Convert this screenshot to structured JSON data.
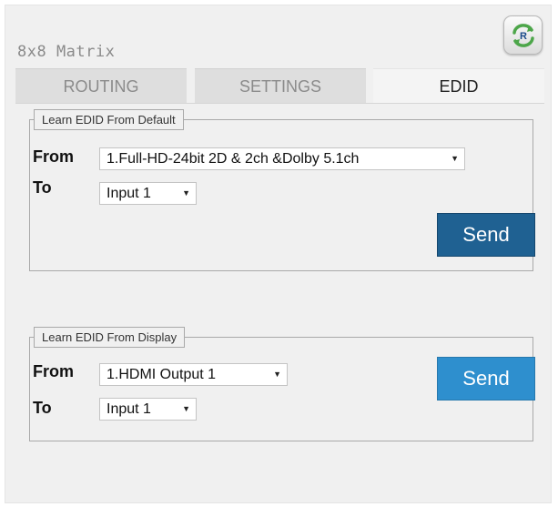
{
  "app": {
    "title": "8x8 Matrix",
    "refresh_button_label": "R"
  },
  "tabs": [
    {
      "label": "ROUTING",
      "active": false
    },
    {
      "label": "SETTINGS",
      "active": false
    },
    {
      "label": "EDID",
      "active": true
    }
  ],
  "default_group": {
    "legend": "Learn EDID From Default",
    "from_label": "From",
    "from_value": "1.Full-HD-24bit 2D & 2ch &Dolby 5.1ch",
    "to_label": "To",
    "to_value": "Input 1",
    "send_label": "Send"
  },
  "display_group": {
    "legend": "Learn EDID From Display",
    "from_label": "From",
    "from_value": "1.HDMI Output 1",
    "to_label": "To",
    "to_value": "Input 1",
    "send_label": "Send"
  },
  "colors": {
    "send_default": "#1f6192",
    "send_display": "#2e8fce",
    "refresh_arrow": "#4da64a"
  }
}
